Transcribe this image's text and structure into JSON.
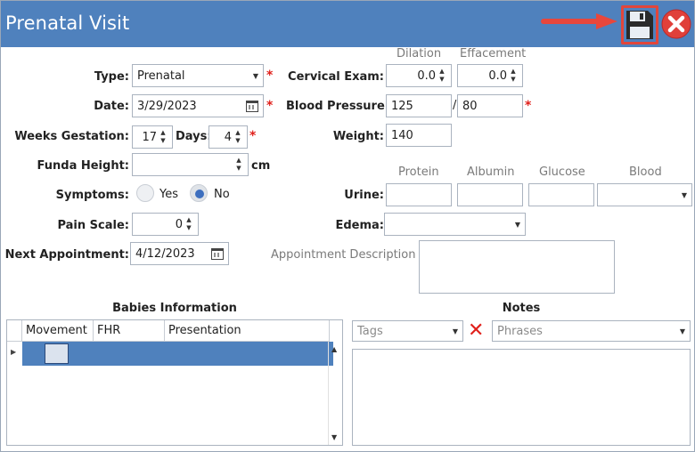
{
  "window": {
    "title": "Prenatal Visit"
  },
  "colors": {
    "titlebar": "#4f81bd",
    "required": "#e0201b",
    "selection": "#4f81bd"
  },
  "icons": {
    "save": "floppy-disk-icon",
    "close": "close-circle-icon",
    "arrow": "red-arrow-icon"
  },
  "form": {
    "type": {
      "label": "Type:",
      "value": "Prenatal",
      "required": "*"
    },
    "date": {
      "label": "Date:",
      "value": "3/29/2023",
      "required": "*"
    },
    "weeks_gestation": {
      "label": "Weeks Gestation:",
      "value": "17"
    },
    "days": {
      "label": "Days:",
      "value": "4",
      "required": "*"
    },
    "funda_height": {
      "label": "Funda Height:",
      "value": "",
      "unit": "cm"
    },
    "symptoms": {
      "label": "Symptoms:",
      "options": [
        "Yes",
        "No"
      ],
      "selected": "No"
    },
    "pain_scale": {
      "label": "Pain Scale:",
      "value": "0"
    },
    "next_appointment": {
      "label": "Next Appointment:",
      "value": "4/12/2023"
    },
    "cervical_exam": {
      "label": "Cervical Exam:",
      "dilation_header": "Dilation",
      "effacement_header": "Effacement",
      "dilation": "0.0",
      "effacement": "0.0"
    },
    "blood_pressure": {
      "label": "Blood Pressure:",
      "systolic": "125",
      "separator": "/",
      "diastolic": "80",
      "required": "*"
    },
    "weight": {
      "label": "Weight:",
      "value": "140"
    },
    "urine": {
      "label": "Urine:",
      "headers": [
        "Protein",
        "Albumin",
        "Glucose",
        "Blood"
      ],
      "protein": "",
      "albumin": "",
      "glucose": "",
      "blood": ""
    },
    "edema": {
      "label": "Edema:",
      "value": ""
    },
    "appointment_description": {
      "label": "Appointment Description",
      "value": ""
    }
  },
  "babies": {
    "title": "Babies Information",
    "columns": [
      "Movement",
      "FHR",
      "Presentation"
    ]
  },
  "notes": {
    "title": "Notes",
    "tags_placeholder": "Tags",
    "phrases_placeholder": "Phrases",
    "clear_symbol": "✕",
    "text": ""
  }
}
